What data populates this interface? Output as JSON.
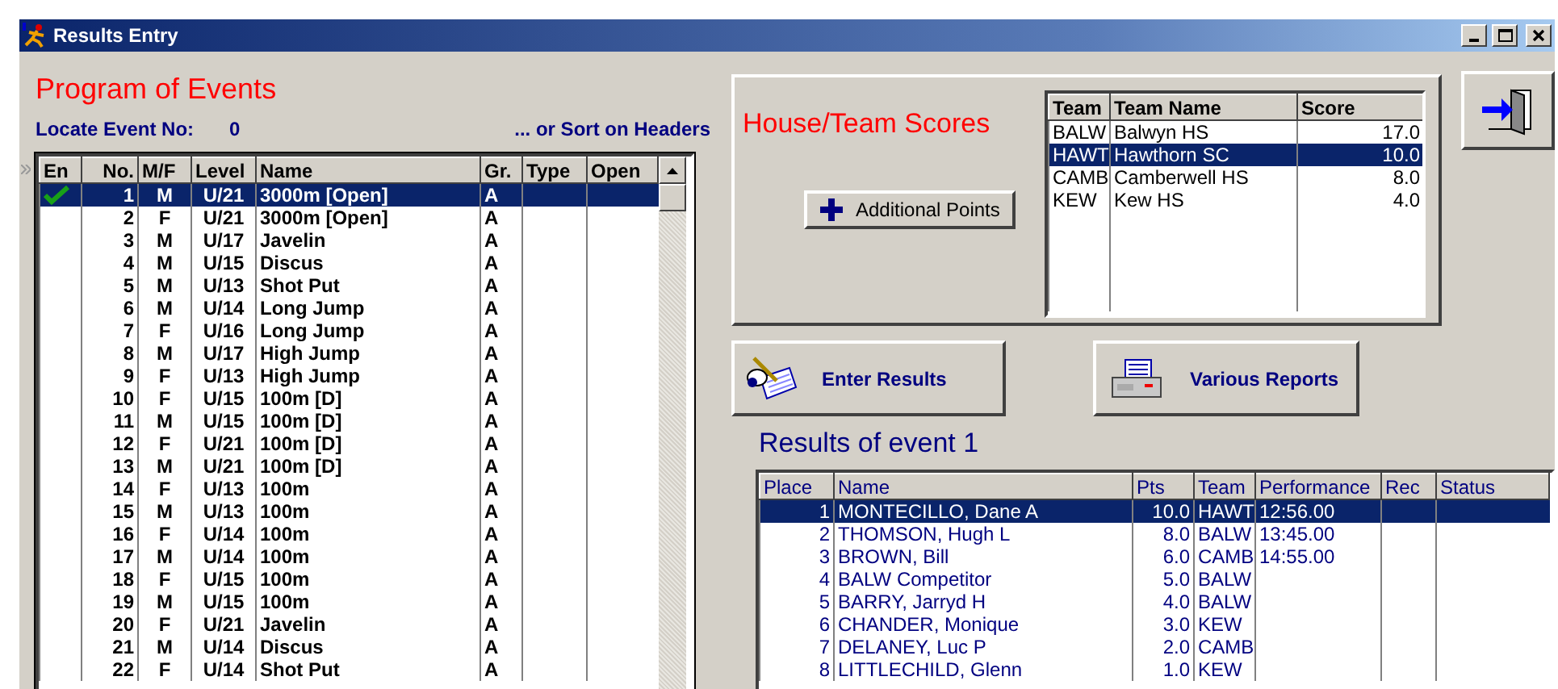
{
  "window": {
    "title": "Results Entry"
  },
  "program": {
    "title": "Program of Events",
    "locate_label": "Locate Event No:",
    "locate_value": "0",
    "sort_hint": "... or Sort on Headers",
    "columns": [
      "En",
      "No.",
      "M/F",
      "Level",
      "Name",
      "Gr.",
      "Type",
      "Open"
    ],
    "rows": [
      {
        "entered": true,
        "selected": true,
        "no": "1",
        "sex": "M",
        "level": "U/21",
        "name": "3000m [Open]",
        "gr": "A"
      },
      {
        "entered": false,
        "selected": false,
        "no": "2",
        "sex": "F",
        "level": "U/21",
        "name": "3000m [Open]",
        "gr": "A"
      },
      {
        "entered": false,
        "selected": false,
        "no": "3",
        "sex": "M",
        "level": "U/17",
        "name": "Javelin",
        "gr": "A"
      },
      {
        "entered": false,
        "selected": false,
        "no": "4",
        "sex": "M",
        "level": "U/15",
        "name": "Discus",
        "gr": "A"
      },
      {
        "entered": false,
        "selected": false,
        "no": "5",
        "sex": "M",
        "level": "U/13",
        "name": "Shot Put",
        "gr": "A"
      },
      {
        "entered": false,
        "selected": false,
        "no": "6",
        "sex": "M",
        "level": "U/14",
        "name": "Long Jump",
        "gr": "A"
      },
      {
        "entered": false,
        "selected": false,
        "no": "7",
        "sex": "F",
        "level": "U/16",
        "name": "Long Jump",
        "gr": "A"
      },
      {
        "entered": false,
        "selected": false,
        "no": "8",
        "sex": "M",
        "level": "U/17",
        "name": "High Jump",
        "gr": "A"
      },
      {
        "entered": false,
        "selected": false,
        "no": "9",
        "sex": "F",
        "level": "U/13",
        "name": "High Jump",
        "gr": "A"
      },
      {
        "entered": false,
        "selected": false,
        "no": "10",
        "sex": "F",
        "level": "U/15",
        "name": "100m [D]",
        "gr": "A"
      },
      {
        "entered": false,
        "selected": false,
        "no": "11",
        "sex": "M",
        "level": "U/15",
        "name": "100m [D]",
        "gr": "A"
      },
      {
        "entered": false,
        "selected": false,
        "no": "12",
        "sex": "F",
        "level": "U/21",
        "name": "100m [D]",
        "gr": "A"
      },
      {
        "entered": false,
        "selected": false,
        "no": "13",
        "sex": "M",
        "level": "U/21",
        "name": "100m [D]",
        "gr": "A"
      },
      {
        "entered": false,
        "selected": false,
        "no": "14",
        "sex": "F",
        "level": "U/13",
        "name": "100m",
        "gr": "A"
      },
      {
        "entered": false,
        "selected": false,
        "no": "15",
        "sex": "M",
        "level": "U/13",
        "name": "100m",
        "gr": "A"
      },
      {
        "entered": false,
        "selected": false,
        "no": "16",
        "sex": "F",
        "level": "U/14",
        "name": "100m",
        "gr": "A"
      },
      {
        "entered": false,
        "selected": false,
        "no": "17",
        "sex": "M",
        "level": "U/14",
        "name": "100m",
        "gr": "A"
      },
      {
        "entered": false,
        "selected": false,
        "no": "18",
        "sex": "F",
        "level": "U/15",
        "name": "100m",
        "gr": "A"
      },
      {
        "entered": false,
        "selected": false,
        "no": "19",
        "sex": "M",
        "level": "U/15",
        "name": "100m",
        "gr": "A"
      },
      {
        "entered": false,
        "selected": false,
        "no": "20",
        "sex": "F",
        "level": "U/21",
        "name": "Javelin",
        "gr": "A"
      },
      {
        "entered": false,
        "selected": false,
        "no": "21",
        "sex": "M",
        "level": "U/14",
        "name": "Discus",
        "gr": "A"
      },
      {
        "entered": false,
        "selected": false,
        "no": "22",
        "sex": "F",
        "level": "U/14",
        "name": "Shot Put",
        "gr": "A"
      }
    ]
  },
  "team_scores": {
    "title": "House/Team Scores",
    "button": "Additional Points",
    "columns": [
      "Team",
      "Team Name",
      "Score"
    ],
    "rows": [
      {
        "selected": false,
        "team": "BALW",
        "name": "Balwyn HS",
        "score": "17.0"
      },
      {
        "selected": true,
        "team": "HAWT",
        "name": "Hawthorn SC",
        "score": "10.0"
      },
      {
        "selected": false,
        "team": "CAMB",
        "name": "Camberwell HS",
        "score": "8.0"
      },
      {
        "selected": false,
        "team": "KEW",
        "name": "Kew HS",
        "score": "4.0"
      }
    ]
  },
  "buttons": [
    {
      "kind": "enter",
      "label": "Enter Results"
    },
    {
      "kind": "reports",
      "label": "Various Reports"
    }
  ],
  "results": {
    "title": "Results of event 1",
    "columns": [
      "Place",
      "Name",
      "Pts",
      "Team",
      "Performance",
      "Rec",
      "Status"
    ],
    "rows": [
      {
        "selected": true,
        "place": "1",
        "name": "MONTECILLO, Dane A",
        "pts": "10.0",
        "team": "HAWT",
        "performance": "12:56.00"
      },
      {
        "selected": false,
        "place": "2",
        "name": "THOMSON, Hugh L",
        "pts": "8.0",
        "team": "BALW",
        "performance": "13:45.00"
      },
      {
        "selected": false,
        "place": "3",
        "name": "BROWN, Bill",
        "pts": "6.0",
        "team": "CAMB",
        "performance": "14:55.00"
      },
      {
        "selected": false,
        "place": "4",
        "name": "BALW Competitor",
        "pts": "5.0",
        "team": "BALW"
      },
      {
        "selected": false,
        "place": "5",
        "name": "BARRY, Jarryd H",
        "pts": "4.0",
        "team": "BALW"
      },
      {
        "selected": false,
        "place": "6",
        "name": "CHANDER, Monique",
        "pts": "3.0",
        "team": "KEW"
      },
      {
        "selected": false,
        "place": "7",
        "name": "DELANEY, Luc P",
        "pts": "2.0",
        "team": "CAMB"
      },
      {
        "selected": false,
        "place": "8",
        "name": "LITTLECHILD, Glenn",
        "pts": "1.0",
        "team": "KEW"
      }
    ]
  }
}
